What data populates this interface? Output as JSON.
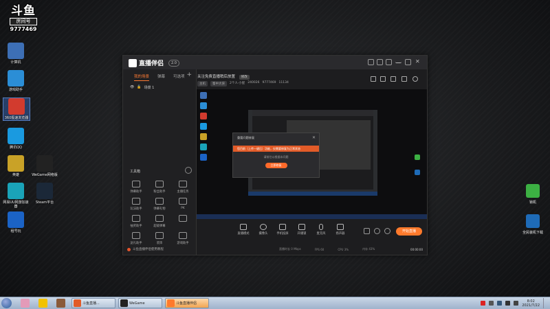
{
  "watermark": {
    "logo": "斗鱼",
    "sub": "房间号",
    "room": "9777469"
  },
  "desktop_icons_left": [
    {
      "label": "计算机",
      "color": "#3d6fb5"
    },
    {
      "label": "游戏助手",
      "color": "#2b8ed6"
    },
    {
      "label": "360极速浏览器",
      "color": "#d23b2e"
    },
    {
      "label": "腾讯QQ",
      "color": "#1a9ae0"
    },
    {
      "label": "英雄",
      "color": "#c9a227"
    },
    {
      "label": "网易UU网游加速器",
      "color": "#1aa3b8"
    },
    {
      "label": "租号玩",
      "color": "#1b63c6"
    }
  ],
  "desktop_icons_col2": [
    {
      "label": "WeGame网络版",
      "color": "#222222"
    },
    {
      "label": "Steam平台",
      "color": "#1b2838"
    }
  ],
  "desktop_icons_right": [
    {
      "label": "锁机",
      "color": "#3cb043"
    },
    {
      "label": "全民装机下载",
      "color": "#1e6bb8"
    }
  ],
  "app": {
    "brand": "直播伴侣",
    "version": "2.0",
    "tabs": [
      "我的场景",
      "弹幕",
      "可选项"
    ],
    "scene_label": "场景 1",
    "tools_title": "工具箱",
    "tools": [
      "弹幕助手",
      "粉丝助手",
      "主播任务",
      "玩法助手",
      "弹幕礼物",
      "PK",
      "抽奖助手",
      "超级弹幕",
      "",
      "送礼助手",
      "装饰",
      "游戏助手"
    ],
    "footer": "斗鱼直播伴侣使用教程",
    "stream_title": "关注免费直播稍后放置",
    "title_tag": "修改",
    "info": [
      "主机",
      "蜀中大侠",
      "2个人·小屋",
      "240026",
      "9777469",
      "11134"
    ],
    "controls": [
      "直播模式",
      "摄像头",
      "手机投屏",
      "开播锁",
      "麦克风",
      "扬声器"
    ],
    "go_live": "开始直播",
    "status": [
      "直播时长 0 Mbps",
      "FPS 60",
      "CPU 3%",
      "内存 43%"
    ],
    "time": "00:00:00"
  },
  "dialog": {
    "title": "重要问题修复",
    "band": "您目前（上传一键后）功能，仅需要修复为正常状态",
    "note": "请前往以根据本问题",
    "button": "立即修复"
  },
  "taskbar": {
    "apps": [
      {
        "label": "斗鱼直播...",
        "color": "#e25b28",
        "active": false
      },
      {
        "label": "WeGame",
        "color": "#222222",
        "active": false
      },
      {
        "label": "斗鱼直播伴侣",
        "color": "#ff7a2c",
        "active": true
      }
    ],
    "clock_time": "8:02",
    "clock_date": "2021/7/22"
  }
}
